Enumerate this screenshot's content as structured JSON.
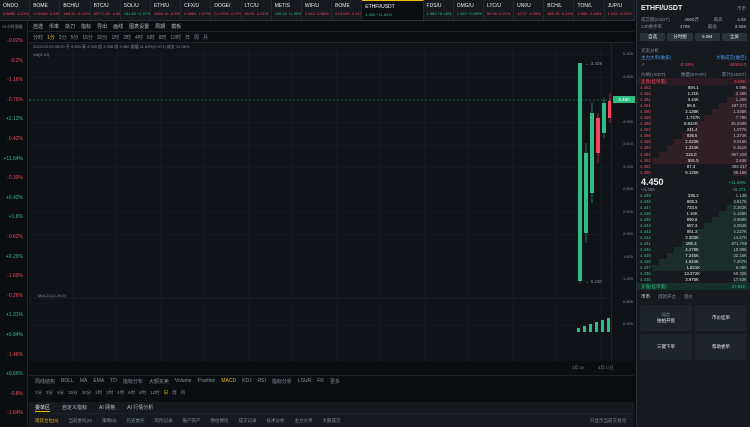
{
  "tabs": [
    {
      "name": "ONDO",
      "change": "0.6850 -0.23%",
      "color": "#f6465d"
    },
    {
      "name": "BOME",
      "change": "0.01048 -0.19%",
      "color": "#f6465d"
    },
    {
      "name": "BCH/U",
      "change": "465.32 -0.12%",
      "color": "#f6465d"
    },
    {
      "name": "BTC/U",
      "change": "69772.20 -0.08%",
      "color": "#f6465d"
    },
    {
      "name": "SOL/U",
      "change": "181.82 +1.07%",
      "color": "#2ebd85"
    },
    {
      "name": "ETH/U",
      "change": "3458.10 -0.29%",
      "color": "#f6465d"
    },
    {
      "name": "CFX/U",
      "change": "0.3884 -1.67%",
      "color": "#f6465d"
    },
    {
      "name": "DOGE/",
      "change": "0.17029 -0.22%",
      "color": "#f6465d"
    },
    {
      "name": "LTC/U",
      "change": "90.95 -0.21%",
      "color": "#f6465d"
    },
    {
      "name": "METIS",
      "change": "106.00 +1.95%",
      "color": "#2ebd85"
    },
    {
      "name": "WIF/U",
      "change": "2.942 -1.58%",
      "color": "#f6465d"
    },
    {
      "name": "BOME",
      "change": "0.01049 -0.11%",
      "color": "#f6465d"
    },
    {
      "name": "ETHFI/USDT",
      "change": "4.450 +11.64%",
      "color": "#2ebd85"
    },
    {
      "name": "FDS/U",
      "change": "1.082 +6.18%",
      "color": "#2ebd85"
    },
    {
      "name": "OMG/U",
      "change": "1.052 +0.99%",
      "color": "#2ebd85"
    },
    {
      "name": "LTC/U",
      "change": "90.96 -0.21%",
      "color": "#f6465d"
    },
    {
      "name": "UNI/U",
      "change": "12.07 -0.35%",
      "color": "#f6465d"
    },
    {
      "name": "BCH/L",
      "change": "465.33 -0.11%",
      "color": "#f6465d"
    },
    {
      "name": "TON/L",
      "change": "4.955 -2.48%",
      "color": "#f6465d"
    },
    {
      "name": "JUP/U",
      "change": "1.032 -2.00%",
      "color": "#f6465d"
    }
  ],
  "leftcol": {
    "header": "24小时涨幅",
    "items": [
      {
        "v": "-0.02%",
        "c": "#f6465d"
      },
      {
        "v": "-0.2%",
        "c": "#f6465d"
      },
      {
        "v": "-1.16%",
        "c": "#f6465d"
      },
      {
        "v": "-0.76%",
        "c": "#f6465d"
      },
      {
        "v": "+2.12%",
        "c": "#2ebd85"
      },
      {
        "v": "-0.42%",
        "c": "#f6465d"
      },
      {
        "v": "+11.64%",
        "c": "#2ebd85"
      },
      {
        "v": "-0.39%",
        "c": "#f6465d"
      },
      {
        "v": "+0.42%",
        "c": "#2ebd85"
      },
      {
        "v": "+1.8%",
        "c": "#2ebd85"
      },
      {
        "v": "-0.62%",
        "c": "#f6465d"
      },
      {
        "v": "+0.29%",
        "c": "#2ebd85"
      },
      {
        "v": "-1.69%",
        "c": "#f6465d"
      },
      {
        "v": "-0.26%",
        "c": "#f6465d"
      },
      {
        "v": "+1.31%",
        "c": "#2ebd85"
      },
      {
        "v": "+0.84%",
        "c": "#2ebd85"
      },
      {
        "v": "-1.46%",
        "c": "#f6465d"
      },
      {
        "v": "+0.66%",
        "c": "#2ebd85"
      },
      {
        "v": "-0.8%",
        "c": "#f6465d"
      },
      {
        "v": "-1.64%",
        "c": "#f6465d"
      }
    ]
  },
  "toolbar1": [
    "自选",
    "币率",
    "杂刀",
    "指标",
    "导出",
    "画线",
    "图表设置",
    "周期",
    "模板"
  ],
  "toolbar2": {
    "periods": [
      "分时",
      "1分",
      "3分",
      "5分",
      "15分",
      "30分",
      "1时",
      "2时",
      "4时",
      "6时",
      "8时",
      "12时",
      "日",
      "周",
      "月"
    ],
    "selected": "1分"
  },
  "chart": {
    "ohlc": "2024-03-29 08:00  开 3.950  高 4.350  低 3.358  收 4.450  振幅 11.63%(0.471)  成交 14.06%",
    "vol_label": "Vol(5,10)",
    "macd_label": "MACD(12,26,9)",
    "high_label": "3.328",
    "low_label": "0.230",
    "last_price": "4.450",
    "y_ticks": [
      "5.200",
      "4.800",
      "4.400",
      "4.000",
      "3.600",
      "3.200",
      "2.800",
      "2.400",
      "2.000",
      "1.600",
      "1.200",
      "0.800",
      "0.400"
    ],
    "time_ticks": [
      "2月 19",
      "3月 17日"
    ]
  },
  "indicators": {
    "items": [
      "周线结构",
      "BOLL",
      "MA",
      "EMA",
      "TD",
      "指标分布",
      "大额买卖",
      "Volume",
      "Position",
      "MACD",
      "KDJ",
      "RSI",
      "指标分析",
      "LSUR",
      "FR",
      "更多"
    ],
    "selected": "MACD"
  },
  "timeframes": [
    "1分",
    "3分",
    "5分",
    "15分",
    "30分",
    "1时",
    "2时",
    "4时",
    "6时",
    "8时",
    "12时",
    "日",
    "周",
    "月"
  ],
  "bottom_tabs": {
    "items": [
      "委单区",
      "自定义指标",
      "AI 网格",
      "AI 行情分析"
    ],
    "selected": "委单区"
  },
  "order_tabs": {
    "items": [
      "现货仓位(0)",
      "当前委托(0)",
      "策略(0)",
      "历史委托",
      "风险记录",
      "账户资产",
      "预估保险",
      "成交记录",
      "技术分析",
      "主力大单",
      "大额成交"
    ],
    "selected": "现货仓位(0)",
    "hide_label": "只显示当前交易对"
  },
  "right": {
    "symbol": "ETHFI/USDT",
    "market": "币币",
    "stats": [
      [
        "成交额(USDT)",
        "4060万",
        "最高",
        "4.55"
      ],
      [
        "24h换手率",
        "4785",
        "最低",
        "3.658"
      ]
    ],
    "buttons": [
      "自选",
      "分时图",
      "5.0M",
      "全屏"
    ],
    "depth_label": "买卖分析",
    "flow_buy": "主力大单(做多)",
    "flow_sell": "大额成交(做空)",
    "flow_vals": [
      "-0.15%",
      "-16164.0"
    ],
    "headers": [
      "价格(USDT)",
      "数量(ETHFI)",
      "累计(USDT)"
    ],
    "ask_label": "卖盘(挂单量)",
    "ask_total": "6.89K",
    "asks": [
      [
        "4.463",
        "894.1",
        "6.89K"
      ],
      [
        "4.462",
        "1.21K",
        "2.48K"
      ],
      [
        "4.461",
        "3.44K",
        "1.26K"
      ],
      [
        "4.461",
        "96.8",
        "297.271"
      ],
      [
        "4.460",
        "2.138K",
        "1.038K"
      ],
      [
        "4.459",
        "1.747K",
        "7.79K"
      ],
      [
        "4.459",
        "8.842K",
        "45.049K"
      ],
      [
        "4.457",
        "241.4",
        "1.077K"
      ],
      [
        "4.456",
        "936.5",
        "1.374K"
      ],
      [
        "4.455",
        "2.023K",
        "9.016K"
      ],
      [
        "4.454",
        "1.224K",
        "5.451K"
      ],
      [
        "4.452",
        "215.0",
        "957.180"
      ],
      [
        "4.452",
        "591.5",
        "2.63K"
      ],
      [
        "4.451",
        "87.4",
        "389.017"
      ],
      [
        "4.450",
        "8.126K",
        "36.16K"
      ]
    ],
    "mid_price": "4.450",
    "mid_sub": "≈4.450",
    "mid_change": "+11.64%",
    "mid_change2": "+0.471",
    "bids": [
      [
        "4.449",
        "236.2",
        "1.14K"
      ],
      [
        "4.448",
        "808.3",
        "3.617K"
      ],
      [
        "4.447",
        "733.6",
        "3.263K"
      ],
      [
        "4.446",
        "1.16K",
        "5.159K"
      ],
      [
        "4.445",
        "890.6",
        "3.959K"
      ],
      [
        "4.444",
        "687.3",
        "3.054K"
      ],
      [
        "4.443",
        "951.3",
        "4.227K"
      ],
      [
        "4.442",
        "3.303K",
        "14.67K"
      ],
      [
        "4.441",
        "196.3",
        "871.768"
      ],
      [
        "4.440",
        "4.278K",
        "18.99K"
      ],
      [
        "4.439",
        "7.245K",
        "32.16K"
      ],
      [
        "4.438",
        "1.624K",
        "7.207K"
      ],
      [
        "4.437",
        "1.821K",
        "8.08K"
      ],
      [
        "4.436",
        "13.372K",
        "59.32K"
      ],
      [
        "4.435",
        "3.975K",
        "17.63K"
      ]
    ],
    "bid_label": "买盘(挂单量)",
    "bid_total": "27.91K",
    "trade_tabs": [
      "币币",
      "借款开仓",
      "现价"
    ],
    "actions": [
      [
        "现货",
        "拍拍开盘"
      ],
      [
        "",
        "市价挂单"
      ],
      [
        "",
        "三键下单"
      ],
      [
        "",
        "帮助委单"
      ]
    ]
  }
}
